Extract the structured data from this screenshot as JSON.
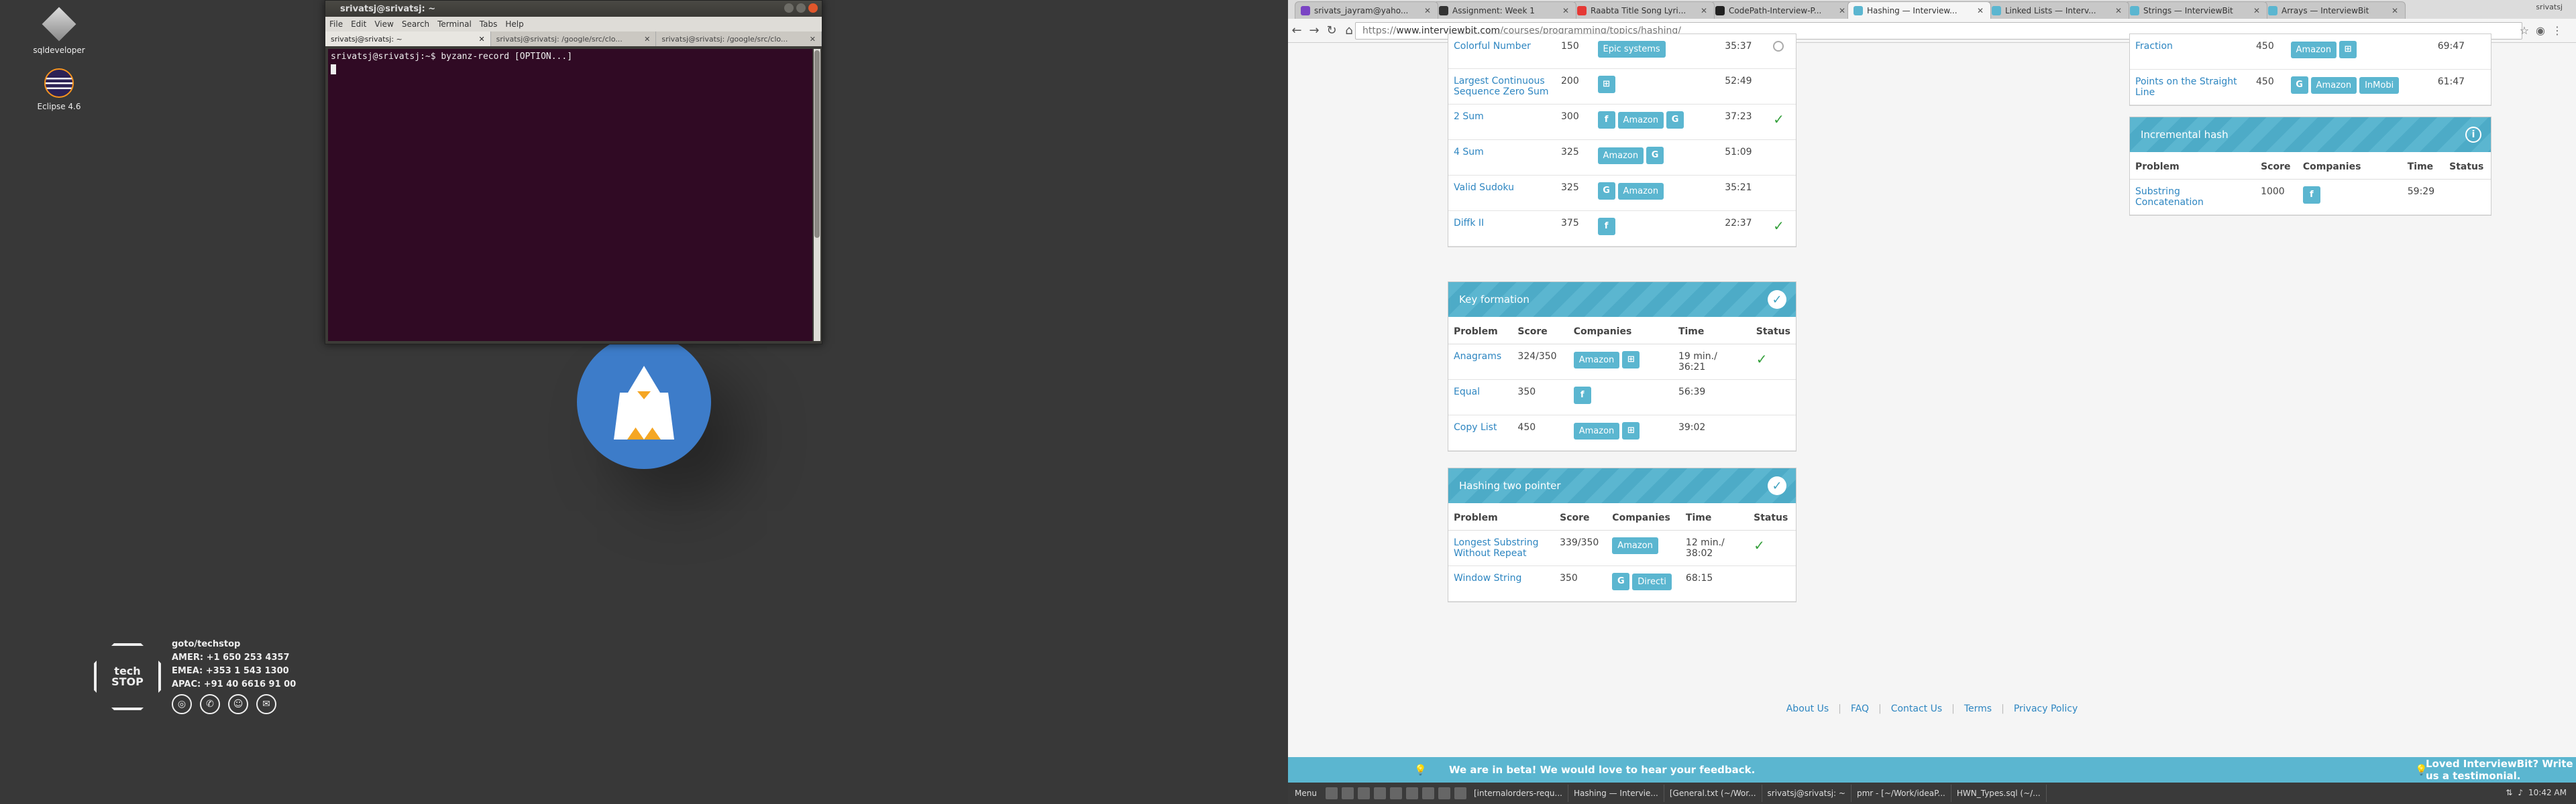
{
  "desktop": {
    "icons": [
      {
        "label": "sqldeveloper",
        "icon": "sqldeveloper-icon"
      },
      {
        "label": "Eclipse 4.6",
        "icon": "eclipse-icon"
      }
    ],
    "techstop": {
      "logo_line1": "tech",
      "logo_line2": "STOP",
      "heading": "goto/techstop",
      "amer": "AMER: +1 650 253 4357",
      "emea": "EMEA: +353 1 543 1300",
      "apac": "APAC:  +91 40 6616 91 00"
    }
  },
  "terminal": {
    "title": "srivatsj@srivatsj: ~",
    "menu": [
      "File",
      "Edit",
      "View",
      "Search",
      "Terminal",
      "Tabs",
      "Help"
    ],
    "tabs": [
      "srivatsj@srivatsj: ~",
      "srivatsj@srivatsj: /google/src/clo...",
      "srivatsj@srivatsj: /google/src/clo..."
    ],
    "prompt_line": "srivatsj@srivatsj:~$ byzanz-record [OPTION...]"
  },
  "browser": {
    "profile": "srivatsj",
    "tabs": [
      {
        "title": "srivats_jayram@yaho...",
        "color": "#7a44c4",
        "active": false
      },
      {
        "title": "Assignment: Week 1",
        "color": "#333333",
        "active": false
      },
      {
        "title": "Raabta Title Song Lyri...",
        "color": "#e53935",
        "active": false
      },
      {
        "title": "CodePath-Interview-P...",
        "color": "#222222",
        "active": false
      },
      {
        "title": "Hashing — Interview...",
        "color": "#5bb6d0",
        "active": true
      },
      {
        "title": "Linked Lists — Interv...",
        "color": "#5bb6d0",
        "active": false
      },
      {
        "title": "Strings — InterviewBit",
        "color": "#5bb6d0",
        "active": false
      },
      {
        "title": "Arrays — InterviewBit",
        "color": "#5bb6d0",
        "active": false
      }
    ],
    "url_scheme": "https://",
    "url_host": "www.interviewbit.com",
    "url_path": "/courses/programming/topics/hashing/"
  },
  "cards": {
    "top_left": {
      "rows": [
        {
          "problem": "Colorful Number",
          "score": "150",
          "companies": [
            "Epic systems"
          ],
          "time": "35:37",
          "status": "clock"
        },
        {
          "problem": "Largest Continuous Sequence Zero Sum",
          "score": "200",
          "companies": [
            "windows-icon"
          ],
          "time": "52:49",
          "status": ""
        },
        {
          "problem": "2 Sum",
          "score": "300",
          "companies": [
            "facebook-icon",
            "Amazon",
            "google-icon"
          ],
          "time": "37:23",
          "status": "check"
        },
        {
          "problem": "4 Sum",
          "score": "325",
          "companies": [
            "Amazon",
            "google-icon"
          ],
          "time": "51:09",
          "status": ""
        },
        {
          "problem": "Valid Sudoku",
          "score": "325",
          "companies": [
            "google-icon",
            "Amazon"
          ],
          "time": "35:21",
          "status": ""
        },
        {
          "problem": "Diffk II",
          "score": "375",
          "companies": [
            "facebook-icon"
          ],
          "time": "22:37",
          "status": "check"
        }
      ]
    },
    "key_formation": {
      "title": "Key formation",
      "headers": [
        "Problem",
        "Score",
        "Companies",
        "Time",
        "Status"
      ],
      "rows": [
        {
          "problem": "Anagrams",
          "score": "324/350",
          "companies": [
            "Amazon",
            "windows-icon"
          ],
          "time": "19 min./ 36:21",
          "status": "check"
        },
        {
          "problem": "Equal",
          "score": "350",
          "companies": [
            "facebook-icon"
          ],
          "time": "56:39",
          "status": ""
        },
        {
          "problem": "Copy List",
          "score": "450",
          "companies": [
            "Amazon",
            "windows-icon"
          ],
          "time": "39:02",
          "status": ""
        }
      ]
    },
    "two_pointer": {
      "title": "Hashing two pointer",
      "headers": [
        "Problem",
        "Score",
        "Companies",
        "Time",
        "Status"
      ],
      "rows": [
        {
          "problem": "Longest Substring Without Repeat",
          "score": "339/350",
          "companies": [
            "Amazon"
          ],
          "time": "12 min./ 38:02",
          "status": "check"
        },
        {
          "problem": "Window String",
          "score": "350",
          "companies": [
            "google-icon",
            "Directi"
          ],
          "time": "68:15",
          "status": ""
        }
      ]
    },
    "top_right": {
      "rows": [
        {
          "problem": "Fraction",
          "score": "450",
          "companies": [
            "Amazon",
            "windows-icon"
          ],
          "time": "69:47",
          "status": ""
        },
        {
          "problem": "Points on the Straight Line",
          "score": "450",
          "companies": [
            "google-icon",
            "Amazon",
            "InMobi"
          ],
          "time": "61:47",
          "status": ""
        }
      ]
    },
    "incremental": {
      "title": "Incremental hash",
      "headers": [
        "Problem",
        "Score",
        "Companies",
        "Time",
        "Status"
      ],
      "rows": [
        {
          "problem": "Substring Concatenation",
          "score": "1000",
          "companies": [
            "facebook-icon"
          ],
          "time": "59:29",
          "status": ""
        }
      ]
    }
  },
  "footer": {
    "links": [
      "About Us",
      "FAQ",
      "Contact Us",
      "Terms",
      "Privacy Policy"
    ]
  },
  "beta": {
    "left": "We are in beta! We would love to hear your feedback.",
    "right": "Loved InterviewBit? Write us a testimonial."
  },
  "taskbar": {
    "menu": "Menu",
    "tasks": [
      "[internalorders-requ...",
      "Hashing — Intervie...",
      "[General.txt (~/Wor...",
      "srivatsj@srivatsj: ~",
      "pmr - [~/Work/ideaP...",
      "HWN_Types.sql (~/..."
    ],
    "clock": "10:42 AM"
  },
  "colors": {
    "accent": "#5bb6d0",
    "link": "#2e86c1",
    "terminal_bg": "#300a24",
    "check": "#35a03c"
  }
}
